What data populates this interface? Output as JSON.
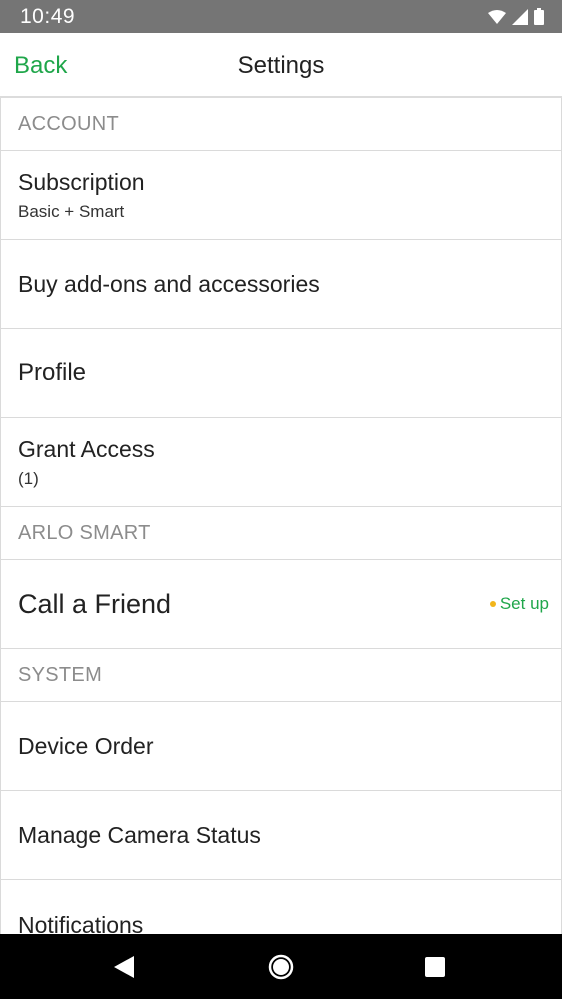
{
  "status_bar": {
    "time": "10:49",
    "icons": [
      "wifi-icon",
      "cell-signal-icon",
      "battery-icon"
    ]
  },
  "header": {
    "back_label": "Back",
    "title": "Settings"
  },
  "sections": {
    "account": {
      "header": "ACCOUNT",
      "subscription": {
        "label": "Subscription",
        "sub": "Basic + Smart"
      },
      "buy_addons": {
        "label": "Buy add-ons and accessories"
      },
      "profile": {
        "label": "Profile"
      },
      "grant_access": {
        "label": "Grant Access",
        "sub": "(1)"
      }
    },
    "arlo_smart": {
      "header": "ARLO SMART",
      "call_friend": {
        "label": "Call a Friend",
        "action": "Set up"
      }
    },
    "system": {
      "header": "SYSTEM",
      "device_order": {
        "label": "Device Order"
      },
      "manage_camera": {
        "label": "Manage Camera Status"
      },
      "notifications": {
        "label": "Notifications"
      }
    }
  },
  "colors": {
    "accent": "#1fa64a",
    "dot": "#f2b51b",
    "status_bar": "#757575",
    "nav_bar": "#000000"
  },
  "nav": [
    "back-triangle-icon",
    "home-circle-icon",
    "recents-square-icon"
  ]
}
